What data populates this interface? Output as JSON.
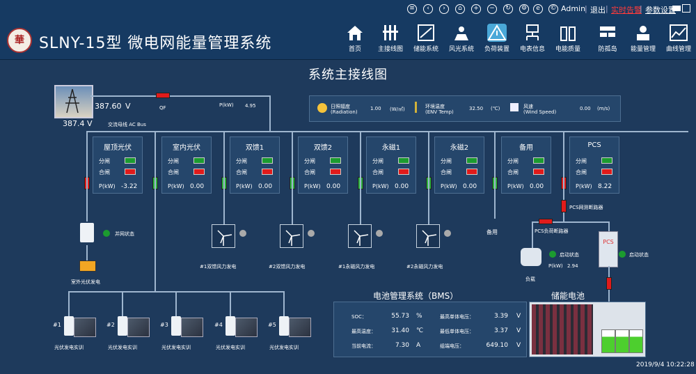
{
  "header": {
    "app_title": "SLNY-15型 微电网能量管理系统",
    "logo_text": "華",
    "user": "Admin",
    "links": [
      "退出",
      "实时告警",
      "参数设置"
    ],
    "icons": [
      "menu-icon",
      "back-icon",
      "forward-icon",
      "home-icon",
      "add-icon",
      "remove-icon",
      "refresh-icon",
      "settings-icon",
      "ie-icon",
      "copyright-icon"
    ],
    "nav": [
      {
        "label": "首页",
        "icon": "home-icon"
      },
      {
        "label": "主接线图",
        "icon": "wiring-icon"
      },
      {
        "label": "储能系统",
        "icon": "storage-icon"
      },
      {
        "label": "风光系统",
        "icon": "solar-icon"
      },
      {
        "label": "负荷装置",
        "icon": "load-icon",
        "active": true
      },
      {
        "label": "电表信息",
        "icon": "meter-icon"
      },
      {
        "label": "电能质量",
        "icon": "quality-icon"
      },
      {
        "label": "防孤岛",
        "icon": "anti-island-icon"
      },
      {
        "label": "能量管理",
        "icon": "energy-icon"
      },
      {
        "label": "曲线管理",
        "icon": "curve-icon"
      }
    ]
  },
  "main": {
    "title": "系统主接线图",
    "grid": {
      "voltage_top": "387.60",
      "voltage_unit": "V",
      "voltage_bottom": "387.4 V",
      "bus_label": "交流母线 AC Bus",
      "qf_label": "QF",
      "p_label": "P(kW)",
      "p_value": "4.95"
    },
    "env": [
      {
        "label1": "日照辐度",
        "label2": "(Radiation)",
        "value": "1.00",
        "unit": "(W/㎡)",
        "icon": "sun-icon"
      },
      {
        "label1": "环境温度",
        "label2": "(ENV Temp)",
        "value": "32.50",
        "unit": "(℃)",
        "icon": "thermometer-icon"
      },
      {
        "label1": "风速",
        "label2": "(Wind Speed)",
        "value": "0.00",
        "unit": "(m/s)",
        "icon": "wind-icon"
      }
    ],
    "feeders": [
      {
        "name": "屋顶光伏",
        "open": "分闸",
        "close": "合闸",
        "p_label": "P(kW)",
        "p": "-3.22"
      },
      {
        "name": "室内光伏",
        "open": "分闸",
        "close": "合闸",
        "p_label": "P(kW)",
        "p": "0.00"
      },
      {
        "name": "双馈1",
        "open": "分闸",
        "close": "合闸",
        "p_label": "P(kW)",
        "p": "0.00"
      },
      {
        "name": "双馈2",
        "open": "分闸",
        "close": "合闸",
        "p_label": "P(kW)",
        "p": "0.00"
      },
      {
        "name": "永磁1",
        "open": "分闸",
        "close": "合闸",
        "p_label": "P(kW)",
        "p": "0.00"
      },
      {
        "name": "永磁2",
        "open": "分闸",
        "close": "合闸",
        "p_label": "P(kW)",
        "p": "0.00"
      },
      {
        "name": "备用",
        "open": "分闸",
        "close": "合闸",
        "p_label": "P(kW)",
        "p": "0.00"
      },
      {
        "name": "PCS",
        "open": "分闸",
        "close": "合闸",
        "p_label": "P(kW)",
        "p": "8.22"
      }
    ],
    "grid_tie": "并网状态",
    "outdoor_pv": "室外光伏发电",
    "wind_turbines": [
      "#1双馈风力发电",
      "#2双馈风力发电",
      "#1永磁风力发电",
      "#2永磁风力发电"
    ],
    "spare": "备用",
    "pcs_grid_breaker": "PCS网测断路器",
    "pcs_load_breaker": "PCS负荷断路器",
    "load": {
      "status": "启动状态",
      "p_label": "P(kW)",
      "p": "2.94",
      "name": "负载"
    },
    "pcs": {
      "status": "启动状态",
      "label": "PCS"
    },
    "pv_trainers": [
      {
        "num": "#1",
        "label": "光伏发电实训"
      },
      {
        "num": "#2",
        "label": "光伏发电实训"
      },
      {
        "num": "#3",
        "label": "光伏发电实训"
      },
      {
        "num": "#4",
        "label": "光伏发电实训"
      },
      {
        "num": "#5",
        "label": "光伏发电实训"
      }
    ],
    "bms": {
      "title": "电池管理系统（BMS）",
      "rows": [
        {
          "l1": "SOC：",
          "v1": "55.73",
          "u1": "%",
          "l2": "最高单体电压：",
          "v2": "3.39",
          "u2": "V"
        },
        {
          "l1": "最高温度：",
          "v1": "31.40",
          "u1": "℃",
          "l2": "最低单体电压：",
          "v2": "3.37",
          "u2": "V"
        },
        {
          "l1": "当前电流：",
          "v1": "7.30",
          "u1": "A",
          "l2": "组端电压：",
          "v2": "649.10",
          "u2": "V"
        }
      ]
    },
    "battery_title": "储能电池",
    "timestamp": "2019/9/4 10:22:28"
  },
  "colors": {
    "bg": "#1e3a5c",
    "header": "#163a62",
    "green": "#1c9b2f",
    "red": "#e01b1b",
    "alert_link": "#ff3b3b"
  }
}
